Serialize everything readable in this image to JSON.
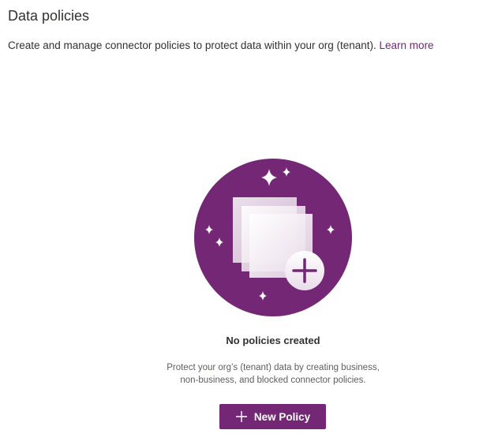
{
  "header": {
    "title": "Data policies",
    "description": "Create and manage connector policies to protect data within your org (tenant). ",
    "learn_more": "Learn more"
  },
  "empty_state": {
    "illustration_icon": "empty-policies-illustration",
    "title": "No policies created",
    "description_line1": "Protect your org’s (tenant) data by creating business,",
    "description_line2": "non-business, and blocked connector policies."
  },
  "actions": {
    "new_policy_label": "New Policy",
    "new_policy_icon": "plus-icon"
  },
  "colors": {
    "brand": "#742774",
    "text_primary": "#323130",
    "text_secondary": "#605e5c",
    "background": "#ffffff"
  }
}
